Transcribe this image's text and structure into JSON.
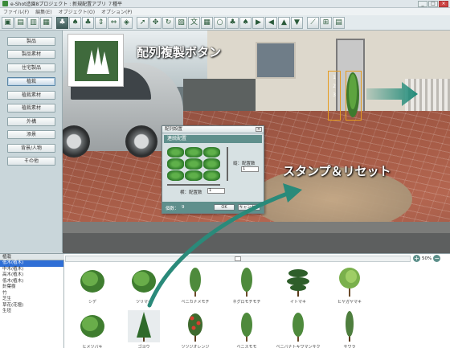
{
  "window": {
    "title": "e-Shot造園8プロジェクト : 新規配置アプリ ７種平"
  },
  "menu": {
    "items": [
      "ファイル(F)",
      "編集(E)",
      "オブジェクト(O)",
      "オプション(P)"
    ]
  },
  "left_buttons": [
    "製品",
    "製品素材",
    "住宅製品",
    "植栽",
    "植栽素材",
    "植栽素材",
    "外構",
    "添景",
    "背景/人物",
    "その他"
  ],
  "active_left_button": 3,
  "callouts": {
    "array_copy": "配列複製ボタン",
    "stamp_reset": "スタンプ＆リセット"
  },
  "selection_labels": [
    "1",
    "2",
    "3"
  ],
  "dialog": {
    "title": "配列設置",
    "header": "連続配置",
    "vertical_label": "縦：配置数",
    "vertical_value": "1",
    "horizontal_label": "横：配置数",
    "horizontal_value": "1",
    "count_label": "個数：",
    "count_value": "9",
    "ok": "OK",
    "cancel": "キャンセル"
  },
  "category": {
    "header": "植栽",
    "items": [
      "低木(植木)",
      "中木(植木)",
      "高木(植木)",
      "低木(植木)",
      "針葉樹",
      "竹",
      "芝生",
      "草花(花壇)",
      "生垣"
    ],
    "active": 0
  },
  "zoom": {
    "label": "50%"
  },
  "plants": [
    {
      "name": "シデ",
      "shape": "round"
    },
    {
      "name": "ツリマキ",
      "shape": "round"
    },
    {
      "name": "ベニカナメモチ",
      "shape": "tall"
    },
    {
      "name": "ネグロモチモチ",
      "shape": "tall"
    },
    {
      "name": "イトマキ",
      "shape": "pine"
    },
    {
      "name": "ヒヤガヤマキ",
      "shape": "fan"
    },
    {
      "name": "ヒメツバキ",
      "shape": "round"
    },
    {
      "name": "ゴヨウ",
      "shape": "conifer"
    },
    {
      "name": "ツツジオレンジ",
      "shape": "flower"
    },
    {
      "name": "ベニスモモ",
      "shape": "tall"
    },
    {
      "name": "ベニバナトキワマンサク",
      "shape": "tall"
    },
    {
      "name": "サワラ",
      "shape": "slim"
    }
  ],
  "selected_plant": 7,
  "colors": {
    "accent": "#5f8f8c",
    "swoosh": "#2a8a7a"
  }
}
